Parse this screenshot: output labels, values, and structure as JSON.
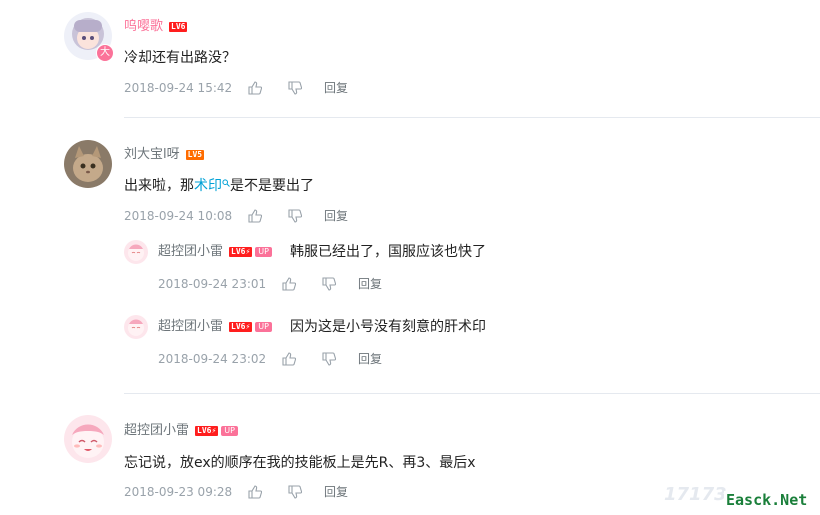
{
  "comments": [
    {
      "user": "呜嘤歌",
      "level": "LV6",
      "text": "冷却还有出路没？",
      "time": "2018-09-24 15:42",
      "reply_label": "回复"
    },
    {
      "user": "刘大宝l呀",
      "level": "LV5",
      "text_before": "出来啦，那",
      "text_link": "术印",
      "text_after": "是不是要出了",
      "time": "2018-09-24 10:08",
      "reply_label": "回复",
      "replies": [
        {
          "user": "超控团小雷",
          "level": "LV6",
          "up_badge": "UP",
          "text": "韩服已经出了，国服应该也快了",
          "time": "2018-09-24 23:01",
          "reply_label": "回复"
        },
        {
          "user": "超控团小雷",
          "level": "LV6",
          "up_badge": "UP",
          "text": "因为这是小号没有刻意的肝术印",
          "time": "2018-09-24 23:02",
          "reply_label": "回复"
        }
      ]
    },
    {
      "user": "超控团小雷",
      "level": "LV6",
      "up_badge": "UP",
      "text": "忘记说，放ex的顺序在我的技能板上是先R、再3、最后x",
      "time": "2018-09-23 09:28",
      "reply_label": "回复"
    }
  ],
  "watermark": {
    "site1": "17173",
    "site2": "Easck.Net"
  },
  "colors": {
    "pink": "#fb7299",
    "link": "#00a1d6",
    "meta": "#99a2aa"
  }
}
